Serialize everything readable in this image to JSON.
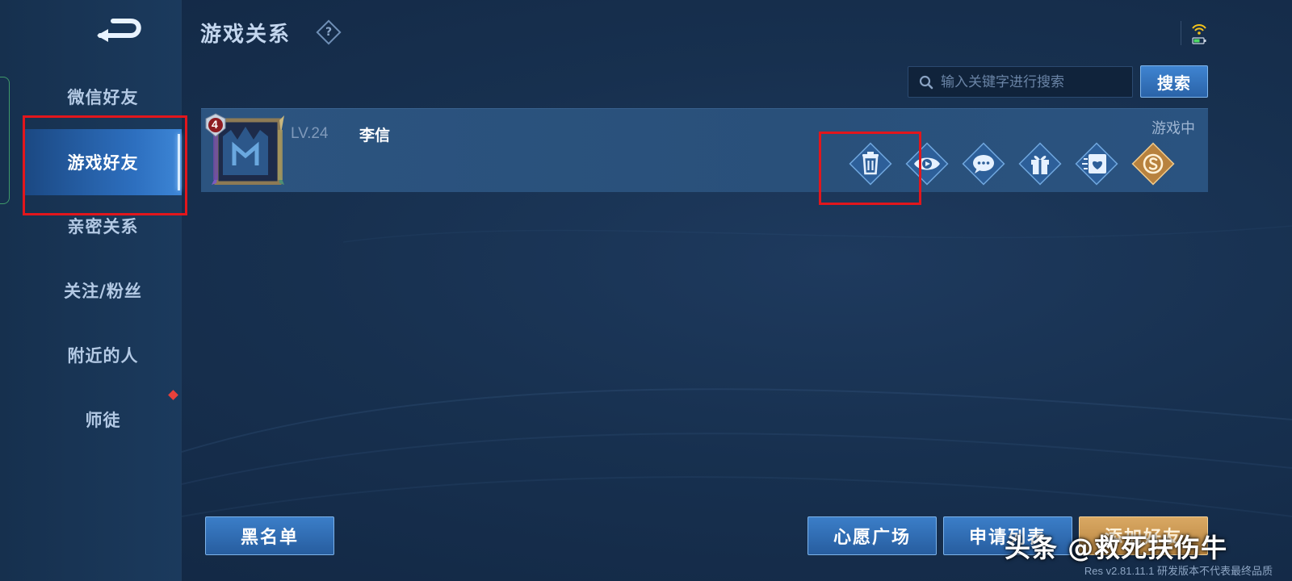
{
  "page": {
    "title": "游戏关系"
  },
  "sidebar": {
    "items": [
      {
        "label": "微信好友"
      },
      {
        "label": "游戏好友",
        "active": true
      },
      {
        "label": "亲密关系"
      },
      {
        "label": "关注/粉丝"
      },
      {
        "label": "附近的人"
      },
      {
        "label": "师徒",
        "badge": "red-diamond"
      }
    ]
  },
  "search": {
    "placeholder": "输入关键字进行搜索",
    "button_label": "搜索"
  },
  "friends": [
    {
      "level": "LV.24",
      "name": "李信",
      "status": "游戏中",
      "rank_badge": "4",
      "actions": [
        "delete-icon",
        "spectate-icon",
        "chat-icon",
        "gift-icon",
        "intimacy-icon",
        "coin-icon"
      ]
    }
  ],
  "bottom": {
    "blacklist_label": "黑名单",
    "wishlist_label": "心愿广场",
    "requests_label": "申请列表",
    "add_friend_label": "添加好友"
  },
  "version": "Res v2.81.11.1 研发版本不代表最终品质",
  "watermark": "头条 @救死扶伤牛",
  "colors": {
    "accent": "#2d6fbf",
    "highlight_box": "#e2161c",
    "gold": "#d9a863",
    "background": "#17304f"
  }
}
